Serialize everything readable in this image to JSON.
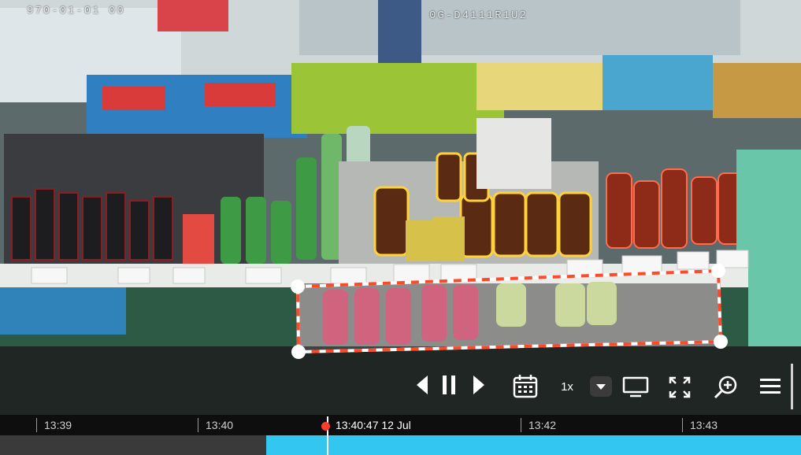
{
  "osd": {
    "datetime_left": "970-01-01 00",
    "camera_id_right": "0G-D4111R1U2"
  },
  "controls": {
    "prev_icon": "step-back-icon",
    "pause_icon": "pause-icon",
    "next_icon": "step-forward-icon",
    "calendar_icon": "calendar-icon",
    "speed": "1x",
    "speed_dropdown_icon": "chevron-down-icon",
    "monitor_icon": "monitor-icon",
    "fullscreen_icon": "fullscreen-icon",
    "zoom_icon": "zoom-in-icon",
    "menu_icon": "hamburger-menu-icon"
  },
  "timeline": {
    "ticks": [
      "13:39",
      "13:40",
      "13:42",
      "13:43"
    ],
    "playhead": "13:40:47 12 Jul",
    "accent": "#33c6ee",
    "playhead_color": "#ff3b2f"
  },
  "selection": {
    "stroke_colors": [
      "#ff4a2a",
      "#ffffff"
    ]
  }
}
